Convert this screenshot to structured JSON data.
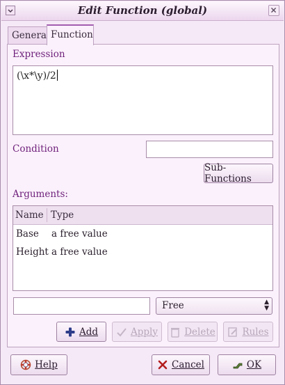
{
  "window": {
    "title": "Edit Function (global)"
  },
  "tabs": [
    {
      "label": "General",
      "active": false
    },
    {
      "label": "Function",
      "active": true
    }
  ],
  "expression": {
    "label": "Expression",
    "value": "(\\x*\\y)/2"
  },
  "condition": {
    "label": "Condition",
    "value": ""
  },
  "subfunctions_button": "Sub-Functions",
  "arguments": {
    "label": "Arguments:",
    "columns": [
      "Name",
      "Type"
    ],
    "rows": [
      {
        "name": "Base",
        "type": "a free value"
      },
      {
        "name": "Height",
        "type": "a free value"
      }
    ],
    "new_name_value": "",
    "type_select": "Free"
  },
  "arg_buttons": {
    "add": "Add",
    "apply": "Apply",
    "delete": "Delete",
    "rules": "Rules"
  },
  "footer": {
    "help": "Help",
    "cancel": "Cancel",
    "ok": "OK"
  },
  "colors": {
    "accent": "#6e1f7a",
    "tab_highlight": "#a35db0",
    "background": "#f6e9f7"
  }
}
